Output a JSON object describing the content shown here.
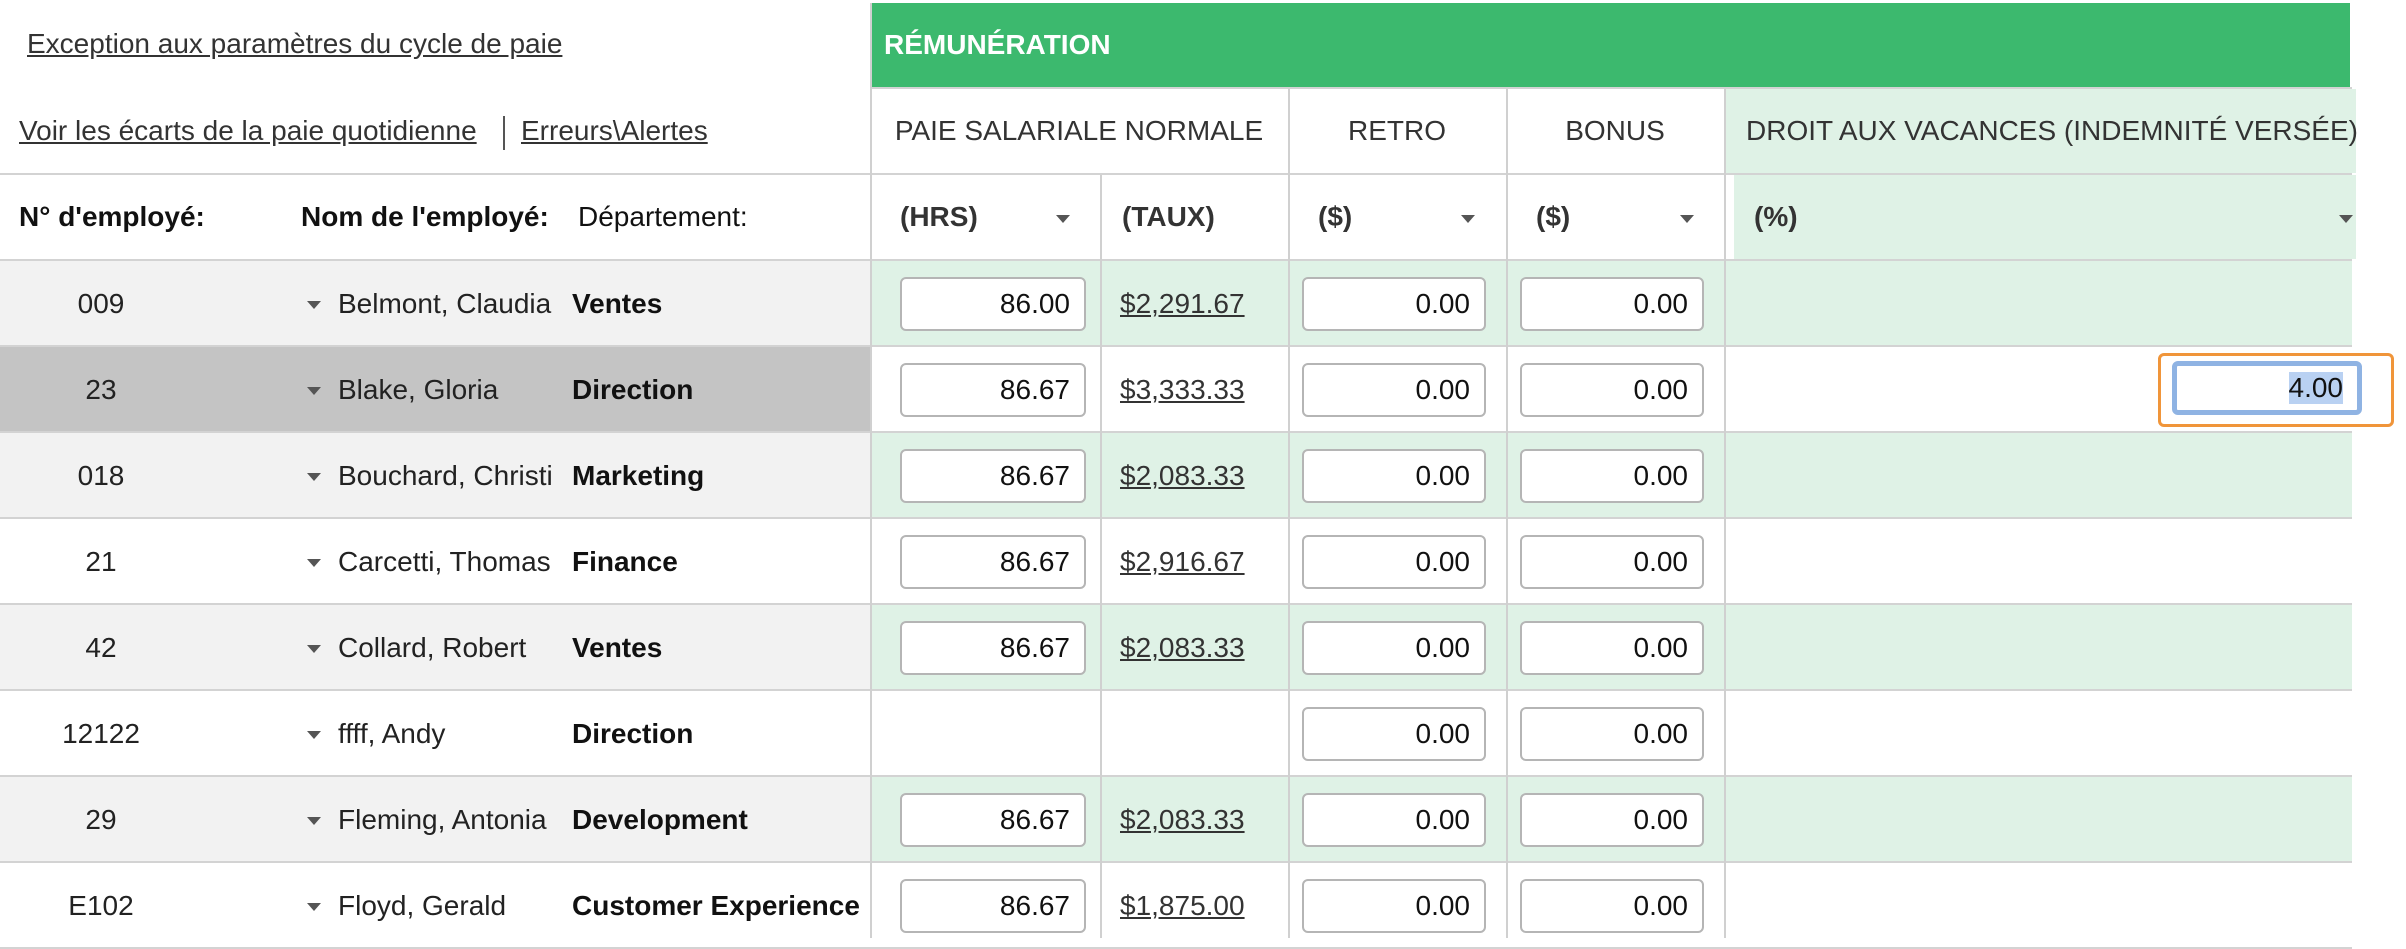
{
  "top_links": {
    "exception": "Exception aux paramètres du cycle de paie",
    "daily_variance": "Voir les écarts de la paie quotidienne",
    "errors": "Erreurs\\Alertes"
  },
  "section_header": "RÉMUNÉRATION",
  "columns": {
    "regular_pay": "PAIE SALARIALE NORMALE",
    "retro": "RETRO",
    "bonus": "BONUS",
    "vacation": "DROIT AUX VACANCES (INDEMNITÉ VERSÉE)"
  },
  "sub_headers": {
    "hrs": "(HRS)",
    "rate": "(TAUX)",
    "retro_unit": "($)",
    "bonus_unit": "($)",
    "vacation_unit": "(%)"
  },
  "left_headers": {
    "emp_no": "N° d'employé:",
    "emp_name": "Nom de l'employé:",
    "department": "Département:"
  },
  "rows": [
    {
      "id": "009",
      "name": "Belmont, Claudia",
      "dept": "Ventes",
      "hrs": "86.00",
      "rate": "$2,291.67",
      "retro": "0.00",
      "bonus": "0.00",
      "vacation": ""
    },
    {
      "id": "23",
      "name": "Blake, Gloria",
      "dept": "Direction",
      "hrs": "86.67",
      "rate": "$3,333.33",
      "retro": "0.00",
      "bonus": "0.00",
      "vacation": "4.00"
    },
    {
      "id": "018",
      "name": "Bouchard, Christi",
      "dept": "Marketing",
      "hrs": "86.67",
      "rate": "$2,083.33",
      "retro": "0.00",
      "bonus": "0.00",
      "vacation": ""
    },
    {
      "id": "21",
      "name": "Carcetti, Thomas",
      "dept": "Finance",
      "hrs": "86.67",
      "rate": "$2,916.67",
      "retro": "0.00",
      "bonus": "0.00",
      "vacation": ""
    },
    {
      "id": "42",
      "name": "Collard, Robert",
      "dept": "Ventes",
      "hrs": "86.67",
      "rate": "$2,083.33",
      "retro": "0.00",
      "bonus": "0.00",
      "vacation": ""
    },
    {
      "id": "12122",
      "name": "ffff, Andy",
      "dept": "Direction",
      "hrs": "",
      "rate": "",
      "retro": "0.00",
      "bonus": "0.00",
      "vacation": ""
    },
    {
      "id": "29",
      "name": "Fleming, Antonia",
      "dept": "Development",
      "hrs": "86.67",
      "rate": "$2,083.33",
      "retro": "0.00",
      "bonus": "0.00",
      "vacation": ""
    },
    {
      "id": "E102",
      "name": "Floyd, Gerald",
      "dept": "Customer Experience",
      "hrs": "86.67",
      "rate": "$1,875.00",
      "retro": "0.00",
      "bonus": "0.00",
      "vacation": ""
    }
  ],
  "colors": {
    "accent_green": "#3cb96e",
    "row_green": "#dff2e6",
    "row_gray": "#f2f2f2",
    "selected_gray": "#c4c4c4",
    "focus_orange": "#f0953a",
    "focus_blue": "#8fb3e3"
  }
}
